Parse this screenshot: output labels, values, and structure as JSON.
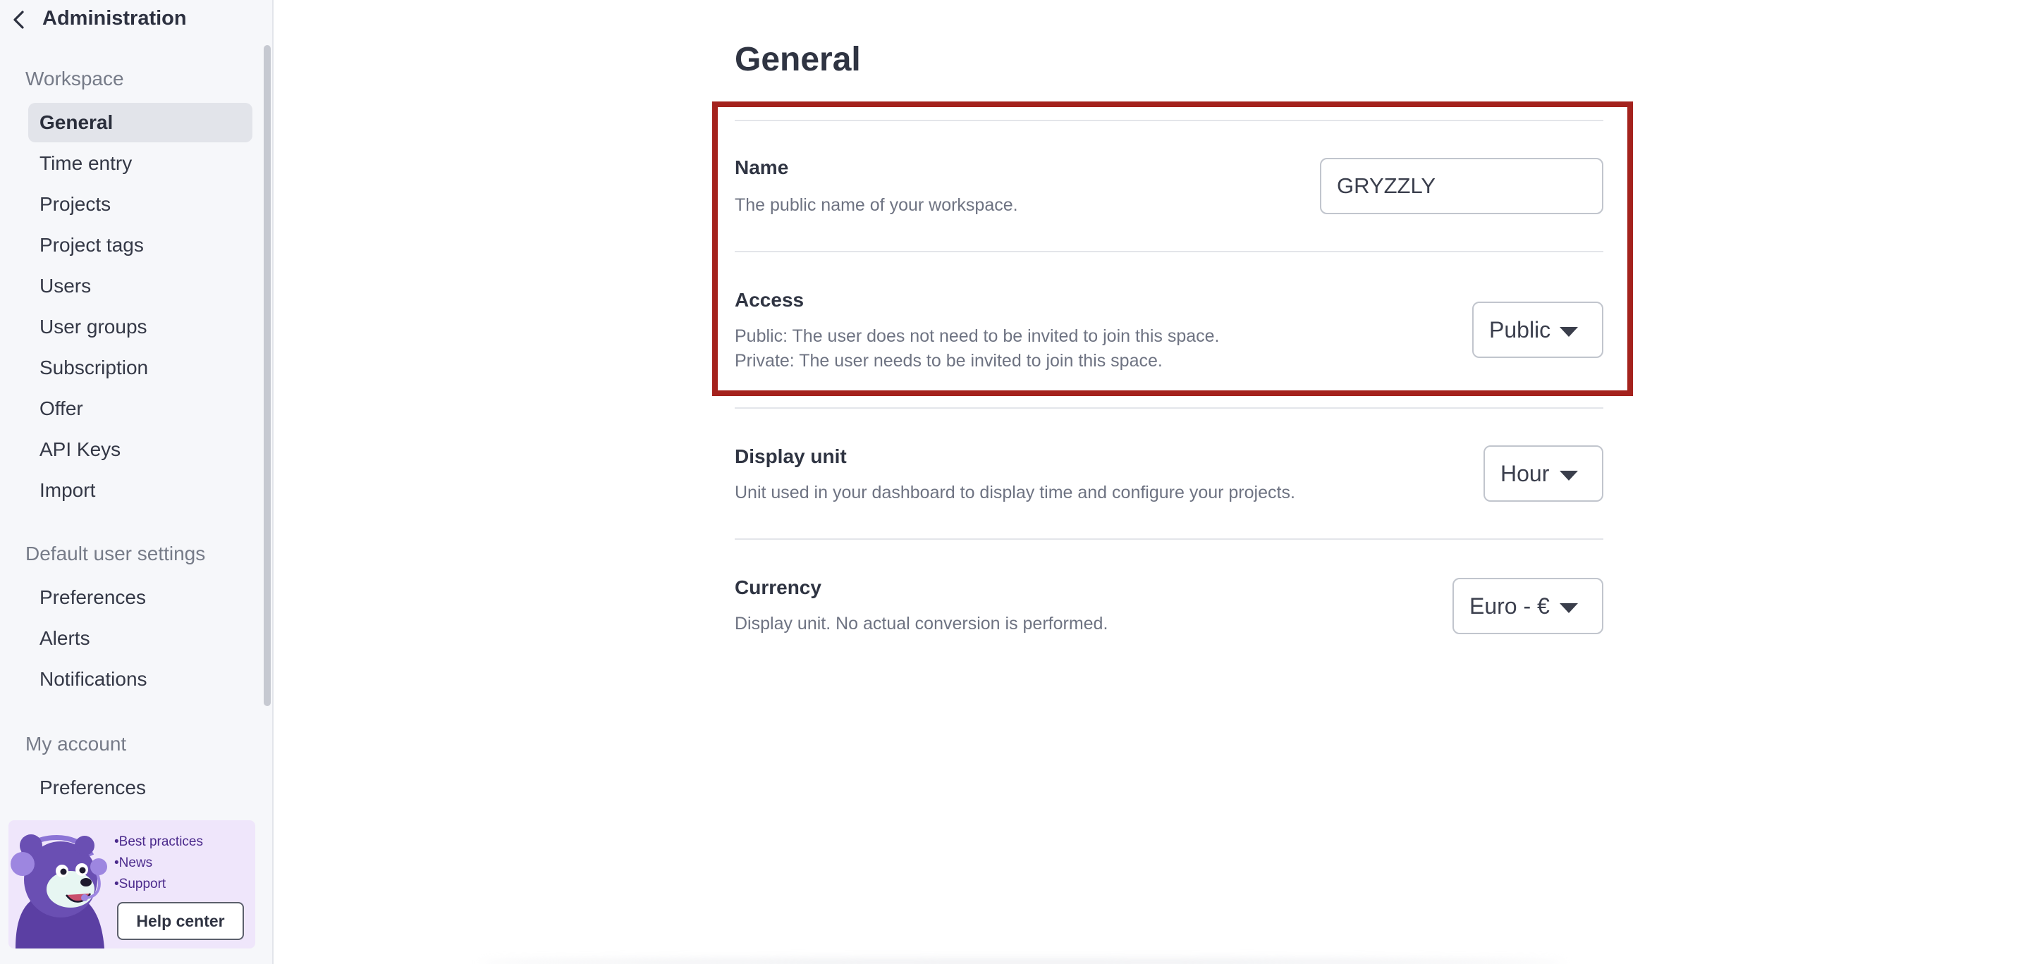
{
  "sidebar": {
    "title": "Administration",
    "sections": [
      {
        "heading": "Workspace",
        "items": [
          "General",
          "Time entry",
          "Projects",
          "Project tags",
          "Users",
          "User groups",
          "Subscription",
          "Offer",
          "API Keys",
          "Import"
        ]
      },
      {
        "heading": "Default user settings",
        "items": [
          "Preferences",
          "Alerts",
          "Notifications"
        ]
      },
      {
        "heading": "My account",
        "items": [
          "Preferences"
        ]
      }
    ],
    "active_item": "General"
  },
  "help_card": {
    "links": [
      "•Best practices",
      "•News",
      "•Support"
    ],
    "button_label": "Help center"
  },
  "main": {
    "title": "General",
    "settings": {
      "name": {
        "label": "Name",
        "description": "The public name of your workspace.",
        "value": "GRYZZLY"
      },
      "access": {
        "label": "Access",
        "description_lines": [
          "Public: The user does not need to be invited to join this space.",
          "Private: The user needs to be invited to join this space."
        ],
        "value": "Public"
      },
      "display_unit": {
        "label": "Display unit",
        "description": "Unit used in your dashboard to display time and configure your projects.",
        "value": "Hour"
      },
      "currency": {
        "label": "Currency",
        "description": "Display unit. No actual conversion is performed.",
        "value": "Euro - €"
      }
    }
  },
  "colors": {
    "highlight_border": "#a4221d",
    "sidebar_bg": "#f6f7fa",
    "active_item_bg": "#e2e4ea",
    "help_card_bg": "#efe6fb",
    "mascot_purple": "#6a4fb3"
  },
  "icons": {
    "back": "chevron-left-icon",
    "select": "caret-down-icon",
    "mascot": "bear-mascot-with-headset"
  }
}
